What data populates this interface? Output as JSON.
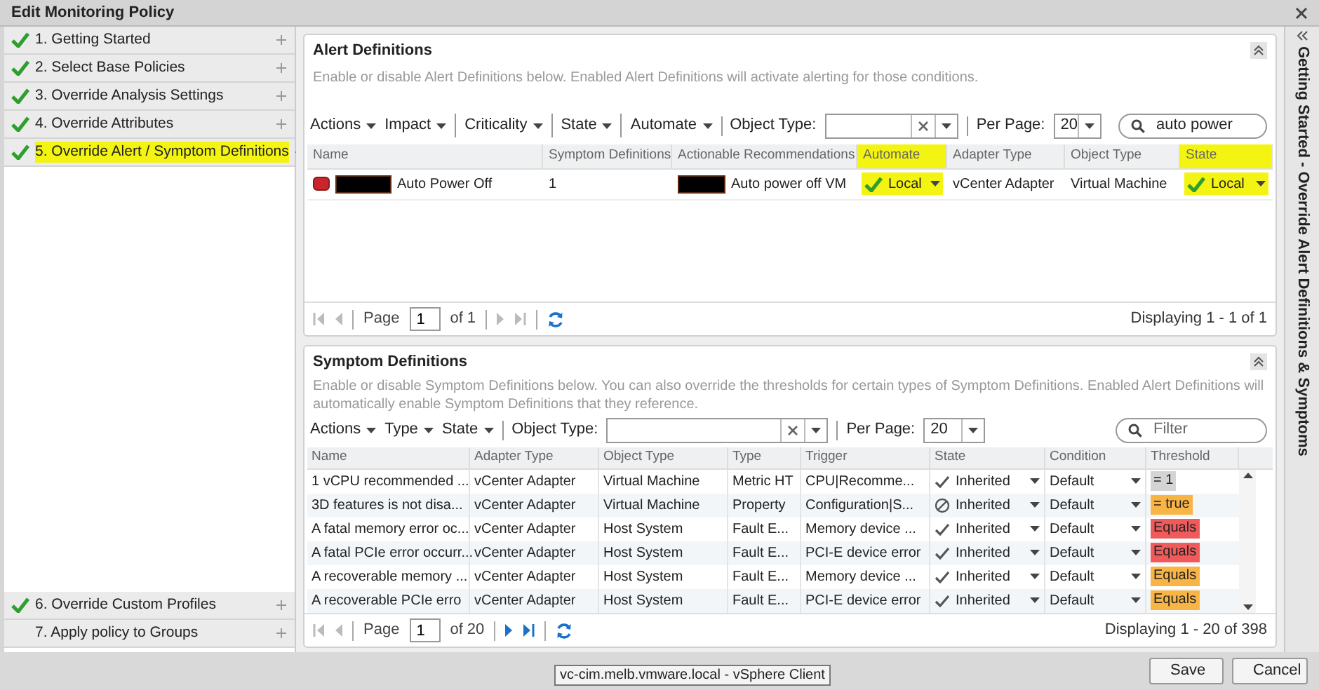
{
  "window": {
    "title": "Edit Monitoring Policy"
  },
  "steps": [
    {
      "label": "1. Getting Started",
      "completed": true,
      "expanded": false,
      "highlighted": false
    },
    {
      "label": "2. Select Base Policies",
      "completed": true,
      "expanded": false,
      "highlighted": false
    },
    {
      "label": "3. Override Analysis Settings",
      "completed": true,
      "expanded": false,
      "highlighted": false
    },
    {
      "label": "4. Override Attributes",
      "completed": true,
      "expanded": false,
      "highlighted": false
    },
    {
      "label": "5. Override Alert / Symptom Definitions",
      "completed": true,
      "expanded": true,
      "highlighted": true
    },
    {
      "label": "6. Override Custom Profiles",
      "completed": true,
      "expanded": false,
      "highlighted": false
    },
    {
      "label": "7. Apply policy to Groups",
      "completed": false,
      "expanded": false,
      "highlighted": false
    }
  ],
  "alert_definitions": {
    "title": "Alert Definitions",
    "description": "Enable or disable Alert Definitions below. Enabled Alert Definitions will activate alerting for those conditions.",
    "toolbar": {
      "menus": [
        {
          "label": "Actions",
          "divider_before": false
        },
        {
          "label": "Impact",
          "divider_before": false
        },
        {
          "label": "Criticality",
          "divider_before": true
        },
        {
          "label": "State",
          "divider_before": true
        },
        {
          "label": "Automate",
          "divider_before": true
        }
      ],
      "object_type_label": "Object Type:",
      "per_page_label": "Per Page:",
      "per_page": "20",
      "search_value": "auto power"
    },
    "columns": [
      {
        "label": "Name",
        "highlighted": false
      },
      {
        "label": "Symptom Definitions",
        "highlighted": false
      },
      {
        "label": "Actionable Recommendations",
        "highlighted": false
      },
      {
        "label": "Automate",
        "highlighted": true
      },
      {
        "label": "Adapter Type",
        "highlighted": false
      },
      {
        "label": "Object Type",
        "highlighted": false
      },
      {
        "label": "State",
        "highlighted": true
      }
    ],
    "rows": [
      {
        "name": "Auto Power Off",
        "symptom_definitions": "1",
        "recommendation": "Auto power off VM",
        "automate": "Local",
        "adapter_type": "vCenter Adapter",
        "object_type": "Virtual Machine",
        "state": "Local"
      }
    ],
    "pager": {
      "page_label": "Page",
      "page": "1",
      "of": "of 1",
      "forward_enabled": false,
      "summary": "Displaying 1 - 1 of 1"
    }
  },
  "symptom_definitions": {
    "title": "Symptom Definitions",
    "description": "Enable or disable Symptom Definitions below. You can also override the thresholds for certain types of Symptom Definitions. Enabled Alert Definitions will automatically enable Symptom Definitions that they reference.",
    "toolbar": {
      "menus": [
        {
          "label": "Actions",
          "divider_before": false
        },
        {
          "label": "Type",
          "divider_before": false
        },
        {
          "label": "State",
          "divider_before": false
        }
      ],
      "object_type_label": "Object Type:",
      "per_page_label": "Per Page:",
      "per_page": "20",
      "search_placeholder": "Filter"
    },
    "columns": [
      "Name",
      "Adapter Type",
      "Object Type",
      "Type",
      "Trigger",
      "State",
      "Condition",
      "Threshold"
    ],
    "rows": [
      {
        "cells": [
          "1 vCPU recommended ...",
          "vCenter Adapter",
          "Virtual Machine",
          "Metric HT",
          "CPU|Recomme..."
        ],
        "state": "Inherited",
        "enabled": true,
        "condition": "Default",
        "threshold": "= 1",
        "color": "#d4d4d4"
      },
      {
        "cells": [
          "3D features is not disa...",
          "vCenter Adapter",
          "Virtual Machine",
          "Property",
          "Configuration|S..."
        ],
        "state": "Inherited",
        "enabled": false,
        "condition": "Default",
        "threshold": "= true",
        "color": "#f8b545"
      },
      {
        "cells": [
          "A fatal memory error oc...",
          "vCenter Adapter",
          "Host System",
          "Fault E...",
          "Memory device ..."
        ],
        "state": "Inherited",
        "enabled": true,
        "condition": "Default",
        "threshold": "Equals",
        "color": "#f05a5a"
      },
      {
        "cells": [
          "A fatal PCIe error occurr...",
          "vCenter Adapter",
          "Host System",
          "Fault E...",
          "PCI-E device error"
        ],
        "state": "Inherited",
        "enabled": true,
        "condition": "Default",
        "threshold": "Equals",
        "color": "#f05a5a"
      },
      {
        "cells": [
          "A recoverable memory ...",
          "vCenter Adapter",
          "Host System",
          "Fault E...",
          "Memory device ..."
        ],
        "state": "Inherited",
        "enabled": true,
        "condition": "Default",
        "threshold": "Equals",
        "color": "#f8b545"
      },
      {
        "cells": [
          "A recoverable PCIe erro",
          "vCenter Adapter",
          "Host System",
          "Fault E...",
          "PCI-E device error"
        ],
        "state": "Inherited",
        "enabled": true,
        "condition": "Default",
        "threshold": "Equals",
        "color": "#f8b545"
      }
    ],
    "pager": {
      "page_label": "Page",
      "page": "1",
      "of": "of 20",
      "forward_enabled": true,
      "summary": "Displaying 1 - 20 of 398"
    }
  },
  "side_panel": {
    "title": "Getting Started - Override Alert Definitions & Symptoms"
  },
  "buttons": [
    "Save",
    "Cancel"
  ],
  "tooltip": "vc-cim.melb.vmware.local - vSphere Client"
}
